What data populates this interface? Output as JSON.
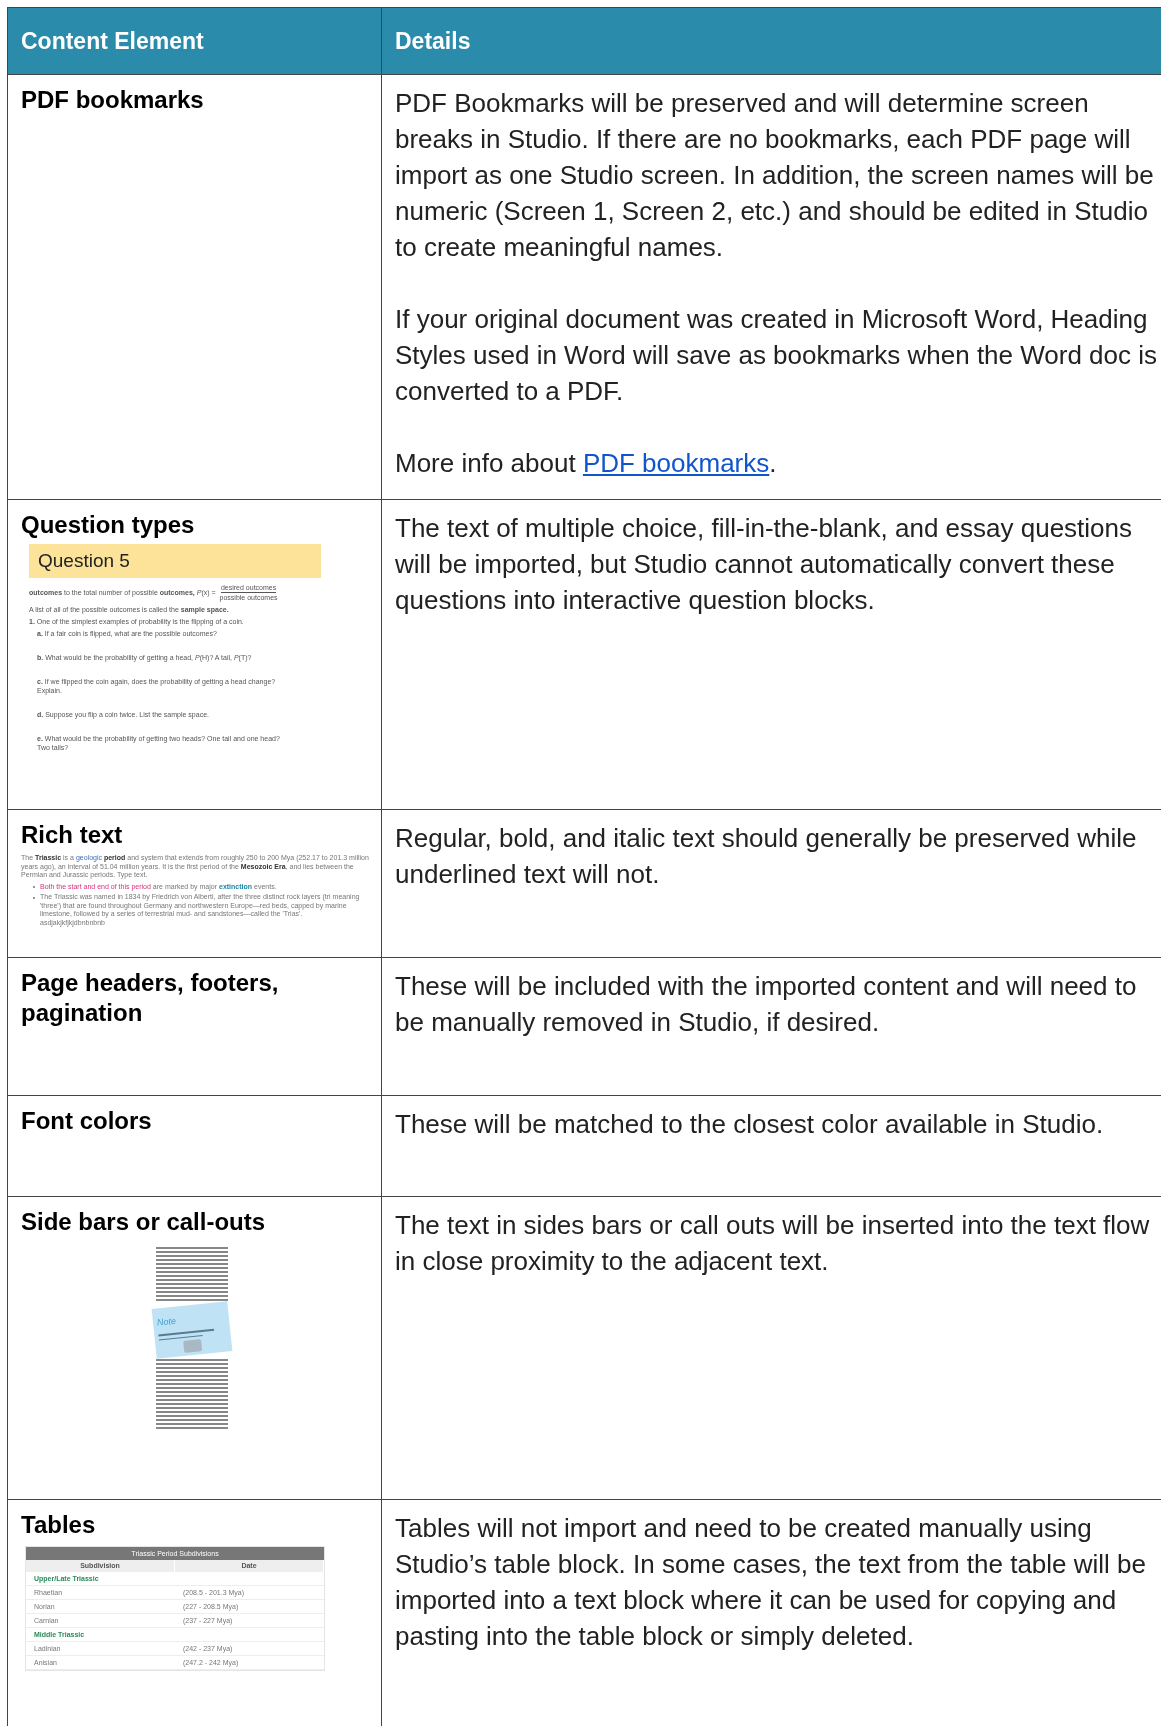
{
  "table": {
    "columns": [
      "Content Element",
      "Details"
    ],
    "rows": [
      {
        "element": "PDF bookmarks",
        "paragraphs": [
          {
            "kind": "text",
            "text": "PDF Bookmarks will be preserved and will determine screen breaks in Studio. If there are no bookmarks, each PDF page will import as one Studio screen. In addition, the screen names will be numeric (Screen 1, Screen 2, etc.) and should be edited in Studio to create meaningful names."
          },
          {
            "kind": "text",
            "text": "If your original document was created in Microsoft Word, Heading Styles used in Word will save as bookmarks when the Word doc is converted to a PDF."
          },
          {
            "kind": "link",
            "before": "More info about ",
            "link": "PDF bookmarks",
            "after": "."
          }
        ]
      },
      {
        "element": "Question types",
        "thumbnail": {
          "kind": "question",
          "heading": "Question 5",
          "formula": "**outcomes** to the total number of possible **outcomes,** *P*(x) =",
          "numerator": "desired outcomes",
          "denominator": "possible outcomes",
          "lines": [
            "A list of all of the possible outcomes is called the **sample space.**",
            "**1.** One of the simplest examples of probability is the flipping of a coin."
          ],
          "items": [
            "**a.** If a fair coin is flipped, what are the possible outcomes?",
            "**b.** What would be the probability of getting a head, *P*(H)? A tail, *P*(T)?",
            "**c.** If we flipped the coin again, does the probability of getting a head change? Explain.",
            "**d.** Suppose you flip a coin twice. List the sample space.",
            "**e.** What would be the probability of getting two heads? One tail and one head? Two tails?"
          ]
        },
        "paragraphs": [
          {
            "kind": "text",
            "text": "The text of multiple choice, fill-in-the-blank, and essay questions will be imported, but Studio cannot automatically convert these questions into interactive question blocks."
          }
        ]
      },
      {
        "element": "Rich text",
        "thumbnail": {
          "kind": "richtext",
          "intro": [
            {
              "kind": "plain",
              "text": "The "
            },
            {
              "kind": "bold",
              "text": "Triassic"
            },
            {
              "kind": "plain",
              "text": " is a "
            },
            {
              "kind": "link",
              "text": "geologic"
            },
            {
              "kind": "bold",
              "text": " period"
            },
            {
              "kind": "plain",
              "text": " and system that extends from roughly 250 to 200 Mya (252.17 to 201.3 million years ago), an interval of 51.04 million years. It is the first period of the "
            },
            {
              "kind": "bold",
              "text": "Mesozoic Era"
            },
            {
              "kind": "plain",
              "text": ", and lies between the Permian and Jurassic periods. Type text."
            }
          ],
          "bullets": [
            [
              {
                "kind": "pink",
                "text": "Both the start and end of this period"
              },
              {
                "kind": "plain",
                "text": " are marked by major "
              },
              {
                "kind": "boldlink",
                "text": "extinction"
              },
              {
                "kind": "plain",
                "text": " events."
              }
            ],
            [
              {
                "kind": "plain",
                "text": "The Triassic was named in 1834 by Friedrich von Alberti, after the three distinct rock layers (tri meaning 'three') that are found throughout Germany and northwestern Europe—red beds, capped by marine limestone, followed by a series of terrestrial mud- and sandstones—called the 'Trias'. asdjakjkfjkjdbnbnbnb"
              }
            ]
          ]
        },
        "paragraphs": [
          {
            "kind": "text",
            "text": "Regular, bold, and italic text should generally be preserved while underlined text will not."
          }
        ]
      },
      {
        "element": "Page headers, footers, pagination",
        "paragraphs": [
          {
            "kind": "text",
            "text": "These will be included with the imported content and will need to be manually removed in Studio, if desired."
          }
        ]
      },
      {
        "element": "Font colors",
        "paragraphs": [
          {
            "kind": "text",
            "text": "These will be matched to the closest color available in Studio."
          }
        ]
      },
      {
        "element": "Side bars or call-outs",
        "thumbnail": {
          "kind": "sidebar",
          "note": "Note"
        },
        "paragraphs": [
          {
            "kind": "text",
            "text": "The text in sides bars or call outs will be inserted into the text flow in close proximity to the adjacent text."
          }
        ]
      },
      {
        "element": "Tables",
        "thumbnail": {
          "kind": "table",
          "title": "Triassic Period Subdivisions",
          "columns": [
            "Subdivision",
            "Date"
          ],
          "rows": [
            {
              "kind": "group",
              "cells": [
                "Upper/Late Triassic"
              ]
            },
            {
              "kind": "row",
              "cells": [
                "Rhaetian",
                "(208.5 - 201.3 Mya)"
              ]
            },
            {
              "kind": "row",
              "cells": [
                "Norian",
                "(227 - 208.5 Mya)"
              ]
            },
            {
              "kind": "row",
              "cells": [
                "Carnian",
                "(237 - 227 Mya)"
              ]
            },
            {
              "kind": "group",
              "cells": [
                "Middle Triassic"
              ]
            },
            {
              "kind": "row",
              "cells": [
                "Ladinian",
                "(242 - 237 Mya)"
              ]
            },
            {
              "kind": "row",
              "cells": [
                "Anisian",
                "(247.2 - 242 Mya)"
              ]
            }
          ]
        },
        "paragraphs": [
          {
            "kind": "text",
            "text": "Tables will not import and need to be created manually using Studio’s table block. In some cases, the text from the table will be imported into a text block where it can be used for copying and pasting into the table block or simply deleted."
          }
        ]
      }
    ]
  }
}
